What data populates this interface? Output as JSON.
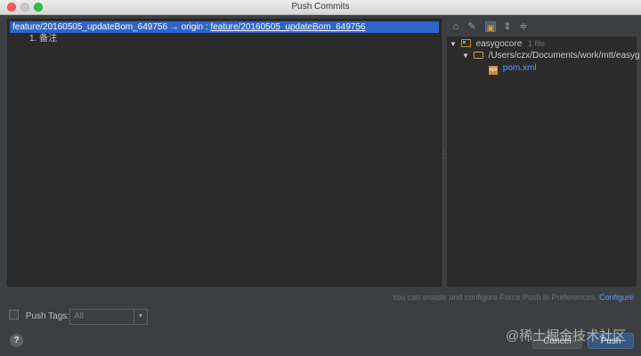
{
  "window": {
    "title": "Push Commits"
  },
  "commits": {
    "branch_source": "feature/20160505_updateBom_649756",
    "arrow": "→",
    "remote": "origin",
    "separator": ":",
    "branch_target": "feature/20160505_updateBom_649756",
    "items": [
      "1. 备注"
    ]
  },
  "changes": {
    "toolbar_icons": [
      "expand-all-icon",
      "edit-source-icon",
      "group-by-directory-icon",
      "expand-icon",
      "collapse-icon"
    ],
    "module": {
      "name": "easygocore",
      "count": "1 file"
    },
    "directory": "/Users/czx/Documents/work/mtt/easyg",
    "file": "pom.xml"
  },
  "footer": {
    "hint_text": "You can enable and configure Force Push in Preferences.",
    "hint_link": "Configure",
    "push_tags_label": "Push Tags:",
    "push_tags_value": "All",
    "cancel_label": "Cancel",
    "push_label": "Push",
    "help_label": "?",
    "watermark": "@稀土掘金技术社区"
  },
  "colors": {
    "background": "#3c3f41",
    "selection": "#2f65ca",
    "link": "#589df6",
    "push_button": "#365880"
  }
}
